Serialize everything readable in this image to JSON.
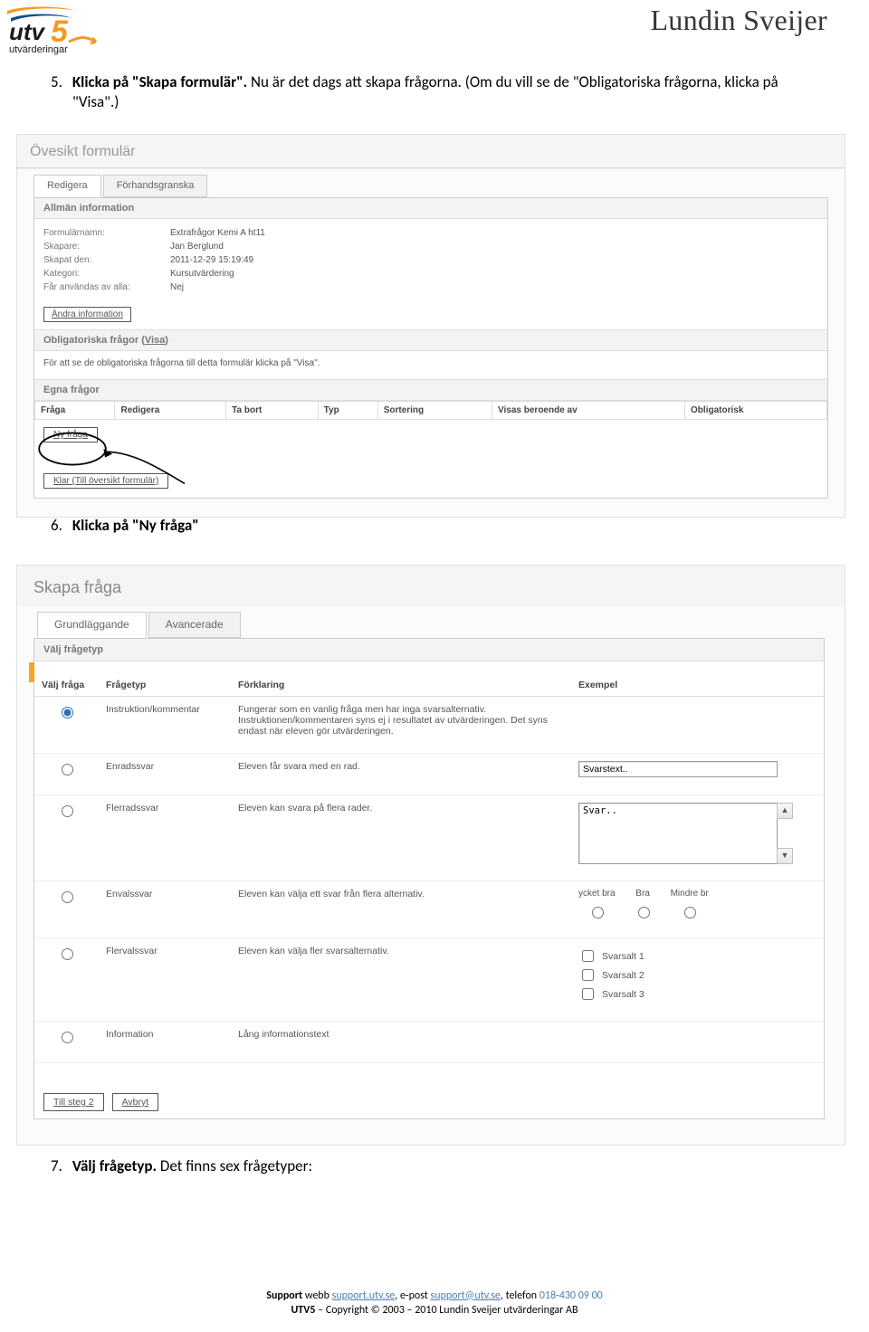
{
  "header": {
    "brand": "Lundin Sveijer",
    "logo_text_top": "utv",
    "logo_text_num": "5",
    "logo_sub": "utvärderingar"
  },
  "steps": {
    "s5": {
      "num": "5.",
      "bold": "Klicka på \"Skapa formulär\".",
      "rest": " Nu är det dags att skapa frågorna. (Om du vill se de \"Obligatoriska frågorna, klicka på \"Visa\".)"
    },
    "s6": {
      "num": "6.",
      "bold": "Klicka på \"Ny fråga\""
    },
    "s7": {
      "num": "7.",
      "bold": "Välj frågetyp.",
      "rest": " Det finns sex frågetyper:"
    }
  },
  "shot1": {
    "title": "Övesikt formulär",
    "tabs": {
      "active": "Redigera",
      "inactive": "Förhandsgranska"
    },
    "section_allman": "Allmän information",
    "info": {
      "rows": [
        {
          "lbl": "Formulärnamn:",
          "val": "Extrafrågor Kemi A ht11"
        },
        {
          "lbl": "Skapare:",
          "val": "Jan Berglund"
        },
        {
          "lbl": "Skapat den:",
          "val": "2011-12-29 15:19:49"
        },
        {
          "lbl": "Kategori:",
          "val": "Kursutvärdering"
        },
        {
          "lbl": "Får användas av alla:",
          "val": "Nej"
        }
      ],
      "btn": "Ändra information"
    },
    "obl": {
      "head_pre": "Obligatoriska frågor (",
      "head_link": "Visa",
      "head_post": ")",
      "text": "För att se de obligatoriska frågorna till detta formulär klicka på \"Visa\"."
    },
    "egna": {
      "head": "Egna frågor",
      "cols": [
        "Fråga",
        "Redigera",
        "Ta bort",
        "Typ",
        "Sortering",
        "Visas beroende av",
        "Obligatorisk"
      ],
      "nyfraga_btn": "Ny fråga"
    },
    "klar_btn": "Klar (Till översikt formulär)"
  },
  "shot2": {
    "title": "Skapa fråga",
    "tabs": {
      "active": "Grundläggande",
      "inactive": "Avancerade"
    },
    "vhead": "Välj frågetyp",
    "cols": {
      "valj": "Välj fråga",
      "typ": "Frågetyp",
      "forkl": "Förklaring",
      "ex": "Exempel"
    },
    "rows": [
      {
        "typ": "Instruktion/kommentar",
        "forkl": "Fungerar som en vanlig fråga men har inga svarsalternativ. Instruktionen/kommentaren syns ej i resultatet av utvärderingen. Det syns endast när eleven gör utvärderingen.",
        "checked": true
      },
      {
        "typ": "Enradssvar",
        "forkl": "Eleven får svara med en rad.",
        "ex_input": "Svarstext.."
      },
      {
        "typ": "Flerradssvar",
        "forkl": "Eleven kan svara på flera rader.",
        "ex_textarea": "Svar.."
      },
      {
        "typ": "Envalssvar",
        "forkl": "Eleven kan välja ett svar från flera alternativ.",
        "ex_envals": [
          "ycket bra",
          "Bra",
          "Mindre br"
        ]
      },
      {
        "typ": "Flervalssvar",
        "forkl": "Eleven kan välja fler svarsalternativ.",
        "ex_flerv": [
          "Svarsalt 1",
          "Svarsalt 2",
          "Svarsalt 3"
        ]
      },
      {
        "typ": "Information",
        "forkl": "Lång informationstext"
      }
    ],
    "btns": {
      "next": "Till steg 2",
      "cancel": "Avbryt"
    }
  },
  "footer": {
    "support_lbl": "Support",
    "webb_lbl": " webb ",
    "webb_link": "support.utv.se",
    "epost_lbl": ", e-post ",
    "epost_link": "support@utv.se",
    "tel_lbl": ", telefon ",
    "tel": "018-430 09 00",
    "line2_pre": "UTV5",
    "line2_rest": " – Copyright © 2003 – 2010 Lundin Sveijer utvärderingar AB"
  }
}
